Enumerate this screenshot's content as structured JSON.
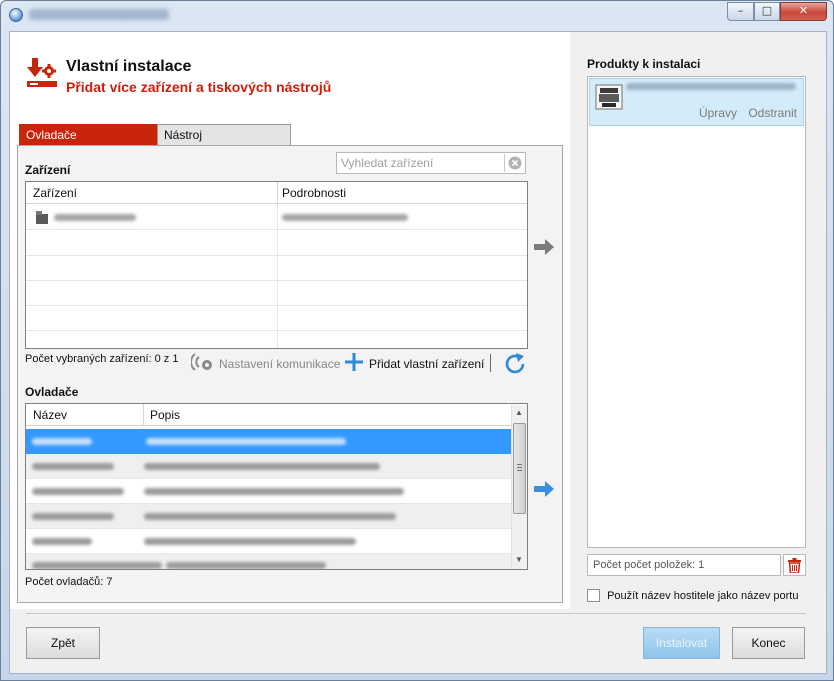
{
  "window": {
    "title": "",
    "controls": {
      "minimize": "–",
      "maximize": "□",
      "close": "✕"
    }
  },
  "header": {
    "title": "Vlastní instalace",
    "subtitle": "Přidat více zařízení a tiskových nástrojů",
    "icon": "download-gear-icon"
  },
  "tabs": [
    {
      "label": "Ovladače",
      "active": true
    },
    {
      "label": "Nástroj",
      "active": false
    }
  ],
  "devices": {
    "section_title": "Zařízení",
    "search_placeholder": "Vyhledat zařízení",
    "columns": [
      "Zařízení",
      "Podrobnosti"
    ],
    "selected_count": "Počet vybraných zařízení: 0 z 1",
    "comm_settings": "Nastavení komunikace",
    "add_custom": "Přidat vlastní zařízení"
  },
  "drivers": {
    "section_title": "Ovladače",
    "columns": [
      "Název",
      "Popis"
    ],
    "count": "Počet ovladačů: 7"
  },
  "products": {
    "title": "Produkty k instalaci",
    "edit": "Úpravy",
    "remove": "Odstranit",
    "count": "Počet počet položek: 1"
  },
  "options": {
    "use_hostname": "Použít název hostitele jako název portu"
  },
  "buttons": {
    "back": "Zpět",
    "install": "Instalovat",
    "close": "Konec"
  },
  "colors": {
    "accent": "#c8250b",
    "selection": "#3399ff",
    "product_selection": "#d4ebfa"
  }
}
